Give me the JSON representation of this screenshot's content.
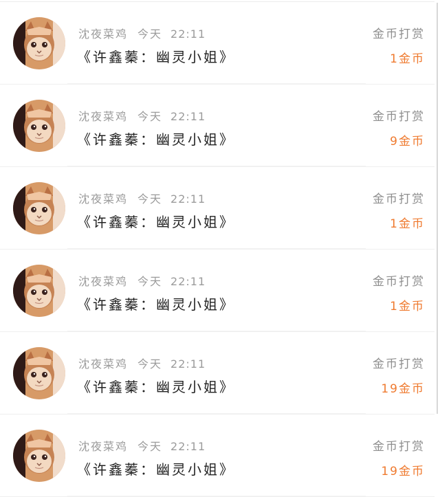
{
  "rows": [
    {
      "user": "沈夜菜鸡",
      "day": "今天",
      "time": "22:11",
      "title": "《许鑫蓁：幽灵小姐》",
      "action": "金币打赏",
      "amount": "1金币"
    },
    {
      "user": "沈夜菜鸡",
      "day": "今天",
      "time": "22:11",
      "title": "《许鑫蓁：幽灵小姐》",
      "action": "金币打赏",
      "amount": "9金币"
    },
    {
      "user": "沈夜菜鸡",
      "day": "今天",
      "time": "22:11",
      "title": "《许鑫蓁：幽灵小姐》",
      "action": "金币打赏",
      "amount": "1金币"
    },
    {
      "user": "沈夜菜鸡",
      "day": "今天",
      "time": "22:11",
      "title": "《许鑫蓁：幽灵小姐》",
      "action": "金币打赏",
      "amount": "1金币"
    },
    {
      "user": "沈夜菜鸡",
      "day": "今天",
      "time": "22:11",
      "title": "《许鑫蓁：幽灵小姐》",
      "action": "金币打赏",
      "amount": "19金币"
    },
    {
      "user": "沈夜菜鸡",
      "day": "今天",
      "time": "22:11",
      "title": "《许鑫蓁：幽灵小姐》",
      "action": "金币打赏",
      "amount": "19金币"
    }
  ],
  "icons": {
    "avatar": "cat-avatar-icon"
  },
  "colors": {
    "amount": "#ef7a2f",
    "meta": "#9b9b9b",
    "title": "#222222"
  }
}
